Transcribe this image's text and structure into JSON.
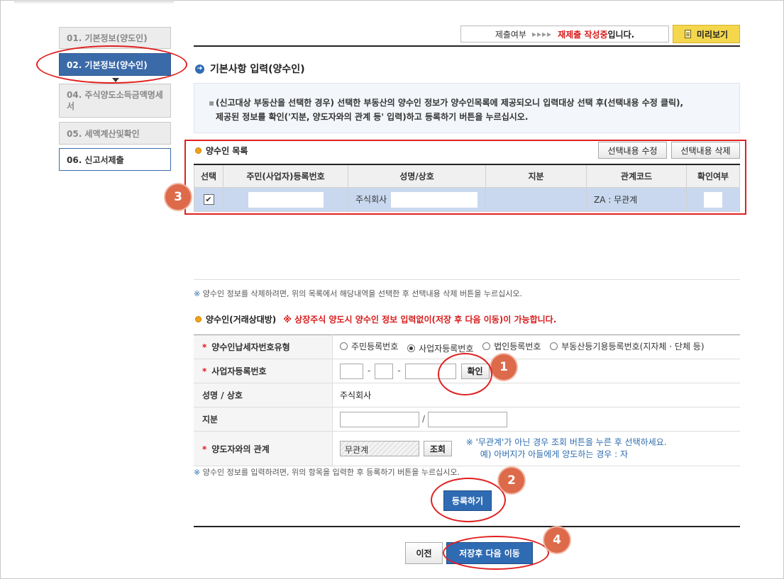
{
  "steps": [
    {
      "label": "01. 기본정보(양도인)"
    },
    {
      "label": "02. 기본정보(양수인)"
    },
    {
      "label": "04. 주식양도소득금액명세서"
    },
    {
      "label": "05. 세액계산및확인"
    },
    {
      "label": "06. 신고서제출"
    }
  ],
  "header": {
    "status_label": "제출여부",
    "status_arrows": "▸▸▸▸",
    "status_value": "재제출 작성중",
    "status_suffix": "입니다.",
    "preview_label": "미리보기"
  },
  "section_title": "기본사항 입력(양수인)",
  "notice": {
    "bullet": "▪",
    "line1": "(신고대상 부동산을 선택한 경우) 선택한 부동산의 양수인 정보가 양수인목록에 제공되오니 입력대상 선택 후(선택내용 수정 클릭),",
    "line2": "제공된 정보를 확인('지분, 양도자와의 관계 등' 입력)하고 등록하기 버튼을 누르십시오."
  },
  "buyer_list": {
    "title": "양수인 목록",
    "edit_button": "선택내용 수정",
    "delete_button": "선택내용 삭제",
    "columns": [
      "선택",
      "주민(사업자)등록번호",
      "성명/상호",
      "지분",
      "관계코드",
      "확인여부"
    ],
    "rows": [
      {
        "checked": "✔",
        "reg_no": "",
        "name_prefix": "주식회사",
        "share": "",
        "relation_code": "ZA : 무관계",
        "confirm": ""
      }
    ]
  },
  "notes": {
    "symbol": "※",
    "delete_note": "양수인 정보를 삭제하려면, 위의 목록에서 해당내역을 선택한 후 선택내용 삭제 버튼을 누르십시오.",
    "register_note": "양수인 정보를 입력하려면, 위의 항목을 입력한 후 등록하기 버튼을 누르십시오."
  },
  "form": {
    "title": "양수인(거래상대방)",
    "warning": "※ 상장주식 양도시 양수인 정보 입력없이(저장 후 다음 이동)이 가능합니다.",
    "required_mark": "*",
    "type_label": "양수인납세자번호유형",
    "type_options": [
      "주민등록번호",
      "사업자등록번호",
      "법인등록번호",
      "부동산등기용등록번호(지자체 · 단체 등)"
    ],
    "type_selected_index": 1,
    "bizno_label": "사업자등록번호",
    "bizno_dash": "-",
    "confirm_button": "확인",
    "name_label": "성명 / 상호",
    "name_value": "주식회사",
    "share_label": "지분",
    "share_sep": "/",
    "relation_label": "양도자와의 관계",
    "relation_value": "무관계",
    "lookup_button": "조회",
    "relation_note1": "※ '무관계'가 아닌 경우 조회 버튼을 누른 후 선택하세요.",
    "relation_note2": "예) 아버지가 아들에게 양도하는 경우 : 자"
  },
  "buttons": {
    "register": "등록하기",
    "prev": "이전",
    "save_next": "저장후 다음 이동"
  },
  "badges": [
    "1",
    "2",
    "3",
    "4"
  ],
  "colors": {
    "accent_blue": "#2f6bb3",
    "annotation_red": "#e02020",
    "badge": "#dd6a4a",
    "preview_yellow": "#f5d74d",
    "selected_row": "#c9d8ef"
  }
}
